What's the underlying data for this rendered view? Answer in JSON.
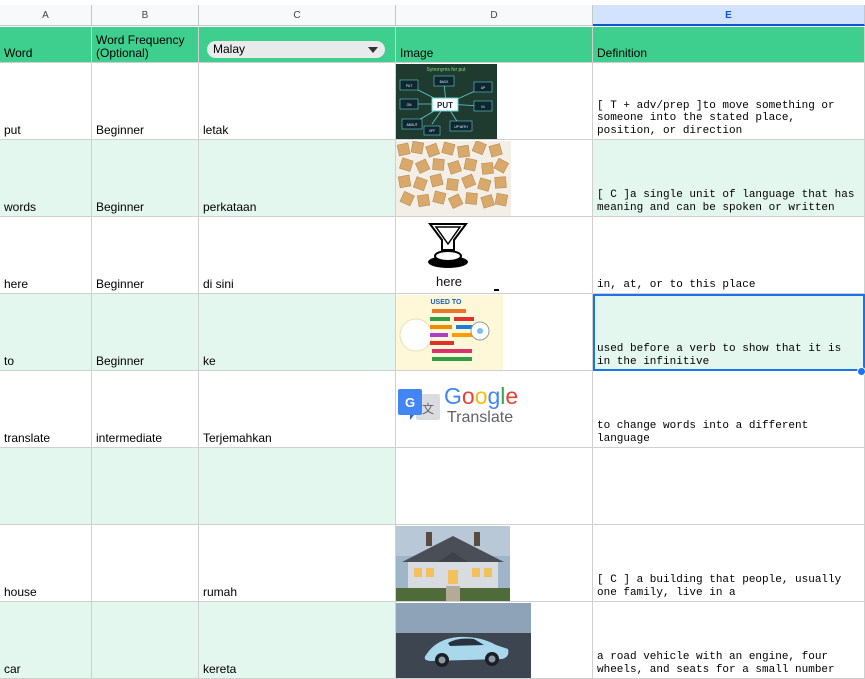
{
  "columns": [
    "A",
    "B",
    "C",
    "D",
    "E"
  ],
  "selected_column": "E",
  "header": {
    "word": "Word",
    "frequency_line1": "Word Frequency",
    "frequency_line2": "(Optional)",
    "language": "Malay",
    "image": "Image",
    "definition": "Definition"
  },
  "rows": [
    {
      "word": "put",
      "frequency": "Beginner",
      "malay": "letak",
      "image": "put-diagram",
      "definition": "[ T + adv/prep ]to move something or someone into the stated place, position, or direction"
    },
    {
      "word": "words",
      "frequency": "Beginner",
      "malay": "perkataan",
      "image": "letter-tiles",
      "definition": "[ C ]a single unit of language that has meaning and can be spoken or written"
    },
    {
      "word": "here",
      "frequency": "Beginner",
      "malay": "di sini",
      "image": "here-arrow",
      "definition": "in, at, or to this place"
    },
    {
      "word": "to",
      "frequency": "Beginner",
      "malay": "ke",
      "image": "used-to-chart",
      "definition": "used before a verb to show that it is in the infinitive"
    },
    {
      "word": "translate",
      "frequency": "intermediate",
      "malay": "Terjemahkan",
      "image": "google-translate-logo",
      "definition": "to change words into a different language"
    },
    {
      "word": "",
      "frequency": "",
      "malay": "",
      "image": "",
      "definition": ""
    },
    {
      "word": "house",
      "frequency": "",
      "malay": "rumah",
      "image": "house-photo",
      "definition": "[ C ] a building that people, usually one family, live in a"
    },
    {
      "word": "car",
      "frequency": "",
      "malay": "kereta",
      "image": "sports-car-photo",
      "definition": "a road vehicle with an engine, four wheels, and seats for a small number"
    }
  ],
  "images": {
    "put_title": "Synonyms for put",
    "put_center": "PUT",
    "put_labels": [
      "PUT",
      "BACK",
      "UP",
      "ABOUT",
      "UP WITH",
      "ON",
      "IN",
      "OFF"
    ],
    "here_label": "here",
    "used_to_title": "USED TO",
    "google_word": "Google",
    "translate_word": "Translate",
    "google_g": "G",
    "translate_glyph": "文"
  },
  "colors": {
    "header_green": "#3ecf8e",
    "band_green": "#e3f7ee",
    "selection_blue": "#1a73e8"
  }
}
